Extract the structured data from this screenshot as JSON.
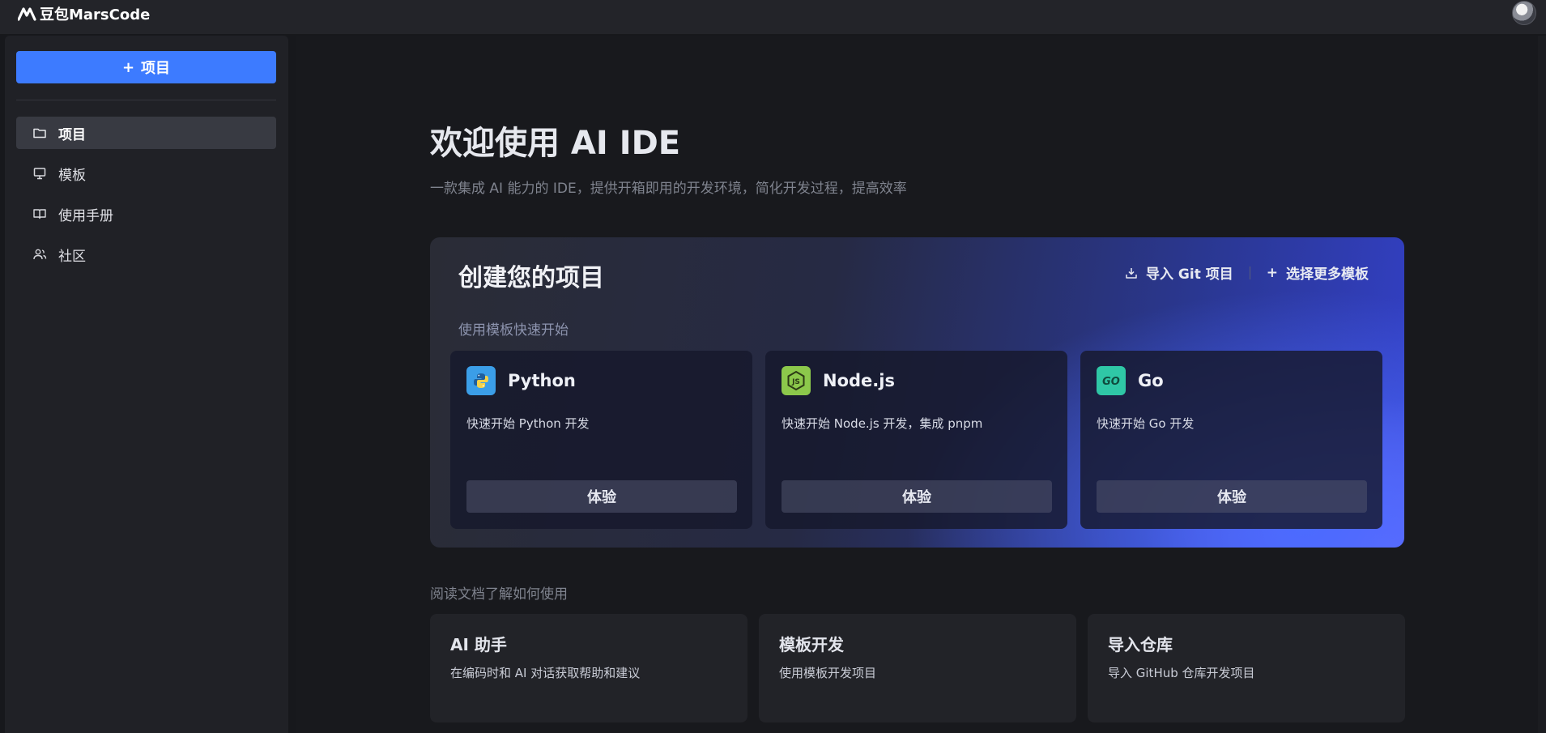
{
  "header": {
    "logo_text": "豆包MarsCode",
    "avatar_label": "",
    "logo_icon": "marscode-logo-icon"
  },
  "sidebar": {
    "new_project_label": "项目",
    "items": [
      {
        "label": "项目",
        "icon": "folder-icon",
        "active": true
      },
      {
        "label": "模板",
        "icon": "monitor-icon",
        "active": false
      },
      {
        "label": "使用手册",
        "icon": "book-icon",
        "active": false
      },
      {
        "label": "社区",
        "icon": "users-icon",
        "active": false
      }
    ]
  },
  "main": {
    "title": "欢迎使用 AI IDE",
    "subtitle": "一款集成 AI 能力的 IDE，提供开箱即用的开发环境，简化开发过程，提高效率",
    "create": {
      "title": "创建您的项目",
      "import_git_label": "导入 Git 项目",
      "more_templates_label": "选择更多模板",
      "templates_label": "使用模板快速开始",
      "templates": [
        {
          "name": "Python",
          "desc": "快速开始 Python 开发",
          "button": "体验",
          "icon": "python-icon",
          "icon_color": "#3b9ee8"
        },
        {
          "name": "Node.js",
          "desc": "快速开始 Node.js 开发，集成 pnpm",
          "button": "体验",
          "icon": "nodejs-icon",
          "icon_color": "#8cc84b"
        },
        {
          "name": "Go",
          "desc": "快速开始 Go 开发",
          "button": "体验",
          "icon": "go-icon",
          "icon_color": "#2fc7a6"
        }
      ]
    },
    "docs_label": "阅读文档了解如何使用",
    "docs": [
      {
        "title": "AI 助手",
        "desc": "在编码时和 AI 对话获取帮助和建议"
      },
      {
        "title": "模板开发",
        "desc": "使用模板开发项目"
      },
      {
        "title": "导入仓库",
        "desc": "导入 GitHub 仓库开发项目"
      }
    ]
  },
  "colors": {
    "accent": "#3d7bff",
    "background": "#18191d",
    "sidebar": "#202126"
  }
}
